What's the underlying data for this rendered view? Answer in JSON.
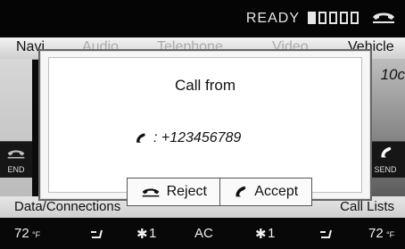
{
  "status": {
    "text": "READY",
    "signal_filled": 1,
    "signal_total": 5
  },
  "menu": {
    "items": [
      {
        "label": "Navi"
      },
      {
        "label": "Audio"
      },
      {
        "label": "Telephone"
      },
      {
        "label": "Video"
      },
      {
        "label": "Vehicle"
      }
    ]
  },
  "background": {
    "right_fragment": "10c"
  },
  "side": {
    "left_label": "END",
    "right_label": "SEND"
  },
  "bottom": {
    "left": "Data/Connections",
    "right": "Call Lists"
  },
  "climate": {
    "left_temp": "72",
    "left_unit": "°F",
    "fan_left": "1",
    "ac": "AC",
    "fan_right": "1",
    "right_temp": "72",
    "right_unit": "°F"
  },
  "dialog": {
    "title": "Call from",
    "number": ": +123456789",
    "reject_label": "Reject",
    "accept_label": "Accept"
  }
}
